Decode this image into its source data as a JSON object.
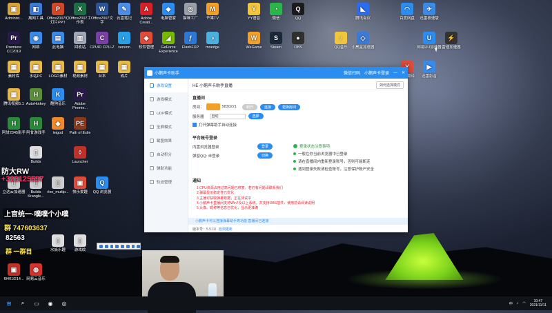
{
  "desktop": {
    "icons": [
      {
        "label": "Administ...",
        "color": "#d9a33a",
        "glyph": "▣"
      },
      {
        "label": "离网工具",
        "color": "#3b7bd8",
        "glyph": "◧"
      },
      {
        "label": "Office2007幻灯片PPT",
        "color": "#d24726",
        "glyph": "P"
      },
      {
        "label": "Office2007工作表",
        "color": "#1d7044",
        "glyph": "X"
      },
      {
        "label": "Office2007文字",
        "color": "#2b579a",
        "glyph": "W"
      },
      {
        "label": "云盘笔记",
        "color": "#4d8ee8",
        "glyph": "✎"
      },
      {
        "label": "Adobe Creati...",
        "color": "#da1f26",
        "glyph": "A"
      },
      {
        "label": "电脑管家",
        "color": "#2b8df0",
        "glyph": "◆"
      },
      {
        "label": "猫咪工厂",
        "color": "#9aa0a8",
        "glyph": "◎"
      },
      {
        "label": "芒果TV",
        "color": "#f2a02a",
        "glyph": "M"
      },
      {
        "label": "Premiere CC2019",
        "color": "#2a1a4a",
        "glyph": "Pr"
      },
      {
        "label": "网络",
        "color": "#3a8ae8",
        "glyph": "◉"
      },
      {
        "label": "此电脑",
        "color": "#3a8ae8",
        "glyph": "▤"
      },
      {
        "label": "回收站",
        "color": "#a0a8b8",
        "glyph": "▥"
      },
      {
        "label": "CPUID CPU-Z",
        "color": "#7b3fa8",
        "glyph": "C"
      },
      {
        "label": "version",
        "color": "#27a0e8",
        "glyph": "◐"
      },
      {
        "label": "软件管理",
        "color": "#e24b3a",
        "glyph": "◈"
      },
      {
        "label": "GeForce Experience",
        "color": "#76b900",
        "glyph": "◢"
      },
      {
        "label": "FlashFXP",
        "color": "#2d78d6",
        "glyph": "ƒ"
      },
      {
        "label": "moedge",
        "color": "#4ab0e0",
        "glyph": "◑"
      },
      {
        "label": "素材库",
        "color": "#e6b84a",
        "glyph": "▦"
      },
      {
        "label": "水站PC",
        "color": "#e6b84a",
        "glyph": "▦"
      },
      {
        "label": "LOGO素材",
        "color": "#e6b84a",
        "glyph": "▦"
      },
      {
        "label": "视频素材",
        "color": "#e6b84a",
        "glyph": "▦"
      },
      {
        "label": "台本",
        "color": "#e6b84a",
        "glyph": "▦"
      },
      {
        "label": "成片",
        "color": "#e6b84a",
        "glyph": "▦"
      },
      {
        "label": "腾讯视频5.1",
        "color": "#e6b84a",
        "glyph": "▦"
      },
      {
        "label": "AutoHotkey",
        "color": "#5b8f3a",
        "glyph": "H"
      },
      {
        "label": "酷狗音乐",
        "color": "#2b8df0",
        "glyph": "K"
      },
      {
        "label": "Adobe Premie...",
        "color": "#2a1a4a",
        "glyph": "Pr"
      },
      {
        "label": "阿甘2345影手",
        "color": "#2a8a3a",
        "glyph": "H"
      },
      {
        "label": "阿甘游戏手",
        "color": "#2a8a3a",
        "glyph": "H"
      },
      {
        "label": "leigod",
        "color": "#f08a2a",
        "glyph": "◆"
      },
      {
        "label": "Path of Exile",
        "color": "#8a3a1a",
        "glyph": "PE"
      },
      {
        "label": "Launcher",
        "color": "#c2302a",
        "glyph": "◊"
      },
      {
        "label": "Builds",
        "color": "#dddddd",
        "glyph": "▯"
      },
      {
        "label": "立达云加速器",
        "color": "#cccccc",
        "glyph": "▯"
      },
      {
        "label": "Builds Krangle...",
        "color": "#cccccc",
        "glyph": "▯"
      },
      {
        "label": "rlxo_multip...",
        "color": "#cccccc",
        "glyph": "▯"
      },
      {
        "label": "快乐爱趣",
        "color": "#e24b3a",
        "glyph": "▣"
      },
      {
        "label": "QQ 浏览器",
        "color": "#2b8df0",
        "glyph": "Q"
      },
      {
        "label": "水族乐趣",
        "color": "#dddddd",
        "glyph": "▯"
      },
      {
        "label": "游戏纹",
        "color": "#dddddd",
        "glyph": "▯"
      },
      {
        "label": "f0401f214...",
        "color": "#c2302a",
        "glyph": "▣"
      },
      {
        "label": "网易云音乐",
        "color": "#d8302a",
        "glyph": "◍"
      },
      {
        "label": "YY语音",
        "color": "#f2c53a",
        "glyph": "Y"
      },
      {
        "label": "微信",
        "color": "#2ab64a",
        "glyph": "◔"
      },
      {
        "label": "QQ",
        "color": "#1b1b1b",
        "glyph": "Q"
      },
      {
        "label": "腾讯会议",
        "color": "#2b6df0",
        "glyph": "◣"
      },
      {
        "label": "百度网盘",
        "color": "#2b8df0",
        "glyph": "◠"
      },
      {
        "label": "迅雷极速版",
        "color": "#3a8ae8",
        "glyph": "✈"
      },
      {
        "label": "WeGame",
        "color": "#f2a02a",
        "glyph": "W"
      },
      {
        "label": "Steam",
        "color": "#1b2838",
        "glyph": "S"
      },
      {
        "label": "OBS",
        "color": "#303030",
        "glyph": "●"
      },
      {
        "label": "QQ音乐",
        "color": "#f2c53a",
        "glyph": "♪"
      },
      {
        "label": "小黑盒加速器",
        "color": "#3b7bd8",
        "glyph": "◇"
      },
      {
        "label": "网易UU加速器",
        "color": "#2b8df0",
        "glyph": "U"
      },
      {
        "label": "雷速加速器",
        "color": "#333333",
        "glyph": "⚡"
      },
      {
        "label": "有道翻译",
        "color": "#e24b3a",
        "glyph": "Y"
      },
      {
        "label": "迅雷影音",
        "color": "#3a8ae8",
        "glyph": "▶"
      }
    ],
    "overlay": {
      "line1": "防大RW",
      "line2": "+323125597",
      "line3": "上官统一·噗噗个小噗",
      "line4": "群 747603637",
      "line5": "82563",
      "line6": "群 一群目"
    }
  },
  "window": {
    "title": "小鹅声卡助手",
    "title_right": [
      "微信扫码",
      "小鹅声卡登录"
    ],
    "sidebar": [
      {
        "label": "游戏设置",
        "icon": "gear-icon"
      },
      {
        "label": "游戏模式",
        "icon": "gamepad-icon"
      },
      {
        "label": "UDP模式",
        "icon": "network-icon"
      },
      {
        "label": "全屏模式",
        "icon": "fullscreen-icon"
      },
      {
        "label": "截图效果",
        "icon": "screenshot-icon"
      },
      {
        "label": "自动积分",
        "icon": "points-icon"
      },
      {
        "label": "辅助功能",
        "icon": "tool-icon"
      },
      {
        "label": "轨迹管理",
        "icon": "track-icon"
      }
    ],
    "header": {
      "title": "HE 小鹅声卡助手直播",
      "button": "如何选择模式"
    },
    "live": {
      "section": "直播间",
      "room_label": "房间：",
      "room_id": "5830221",
      "btn_gray": "断开",
      "btn_connect": "连接",
      "btn_more": "更换房间",
      "server_label": "服务器",
      "server_value": "自动",
      "server_btn": "选择",
      "auto_check": "打开弹幕助手自动连接"
    },
    "account": {
      "section": "平台账号登录",
      "row1_label": "内置浏览器登录",
      "row1_btn": "登录",
      "row2_label": "弹窗QQ: 未登录",
      "row2_btn": "切换",
      "tip_title": "登录状态注意事项",
      "tips": [
        "一般在你当前浏览器中已登录",
        "请在直播间内重新登录账号，否则可能断连",
        "遇到登录失败请检查账号，注意保护账户安全"
      ]
    },
    "notice": {
      "section": "通知",
      "lines": [
        "1.CPU资源占用过高问题已修复，若仍有问题请联系我们",
        "2.弹幕显示稳定性已优化",
        "3.主播可获取弹幕数据，正在测试中",
        "4.小鹅声卡直播间支持Win7及以上系统，并支持OBS插件，使用前请阅读说明",
        "5.头像、昵称等信息已优化，显示更准确"
      ]
    },
    "infobar": "小鹅声卡可以连接弹幕助手等功能   直播间已连接",
    "version": "版本号：5.5.10",
    "version_link": "检测更新"
  },
  "taskbar": {
    "start": "⊞",
    "items": [
      "⌕",
      "▭",
      "◉",
      "◎"
    ],
    "tray_ime": "中",
    "time": "10:47",
    "date": "2021/11/11"
  }
}
